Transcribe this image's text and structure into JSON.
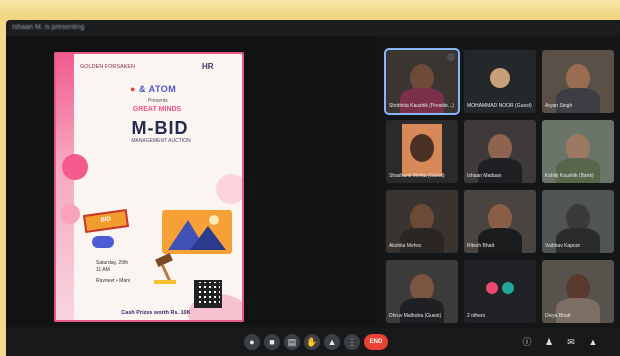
{
  "meeting": {
    "presenting_text": "Ishaan M. is presenting"
  },
  "poster": {
    "org_text": "GOLDEN FORSAKEN",
    "org_sub": "HR",
    "atom_text": "ATOM",
    "presents_text": "Presents",
    "event_title": "GREAT MINDS",
    "headline": "M-BID",
    "subheadline": "MANAGEMENT AUCTION",
    "sticker_text": "BID",
    "details_date": "Saturday, 20th",
    "details_time": "11 AM",
    "details_contact": "Ravneet • Mani",
    "footer_text": "Cash Prizes worth Rs. 10K"
  },
  "participants": [
    {
      "name": "Shobhita Kaushik (Preside...)"
    },
    {
      "name": "MOHAMMAD NOOR (Guest)"
    },
    {
      "name": "Aryan Singh"
    },
    {
      "name": "Shashank Mehta (Guest)"
    },
    {
      "name": "Ishaan Madaan"
    },
    {
      "name": "Kshitij Kaushik (Bank)"
    },
    {
      "name": "Akshita Mehra"
    },
    {
      "name": "Ritesh Bhatt"
    },
    {
      "name": "Vaibhav Kapoor"
    },
    {
      "name": "Dhruv Malhotra (Guest)"
    },
    {
      "name": "2 others"
    },
    {
      "name": "Divya Bhatt"
    }
  ],
  "toolbar": {
    "end_call_label": "END"
  },
  "icons": {
    "mic": "mic-icon",
    "camera": "camera-icon",
    "captions": "captions-icon",
    "hand": "raise-hand-icon",
    "present": "present-screen-icon",
    "more": "more-options-icon",
    "end": "end-call-icon",
    "info": "info-icon",
    "people": "people-icon",
    "chat": "chat-icon",
    "activities": "activities-icon"
  }
}
